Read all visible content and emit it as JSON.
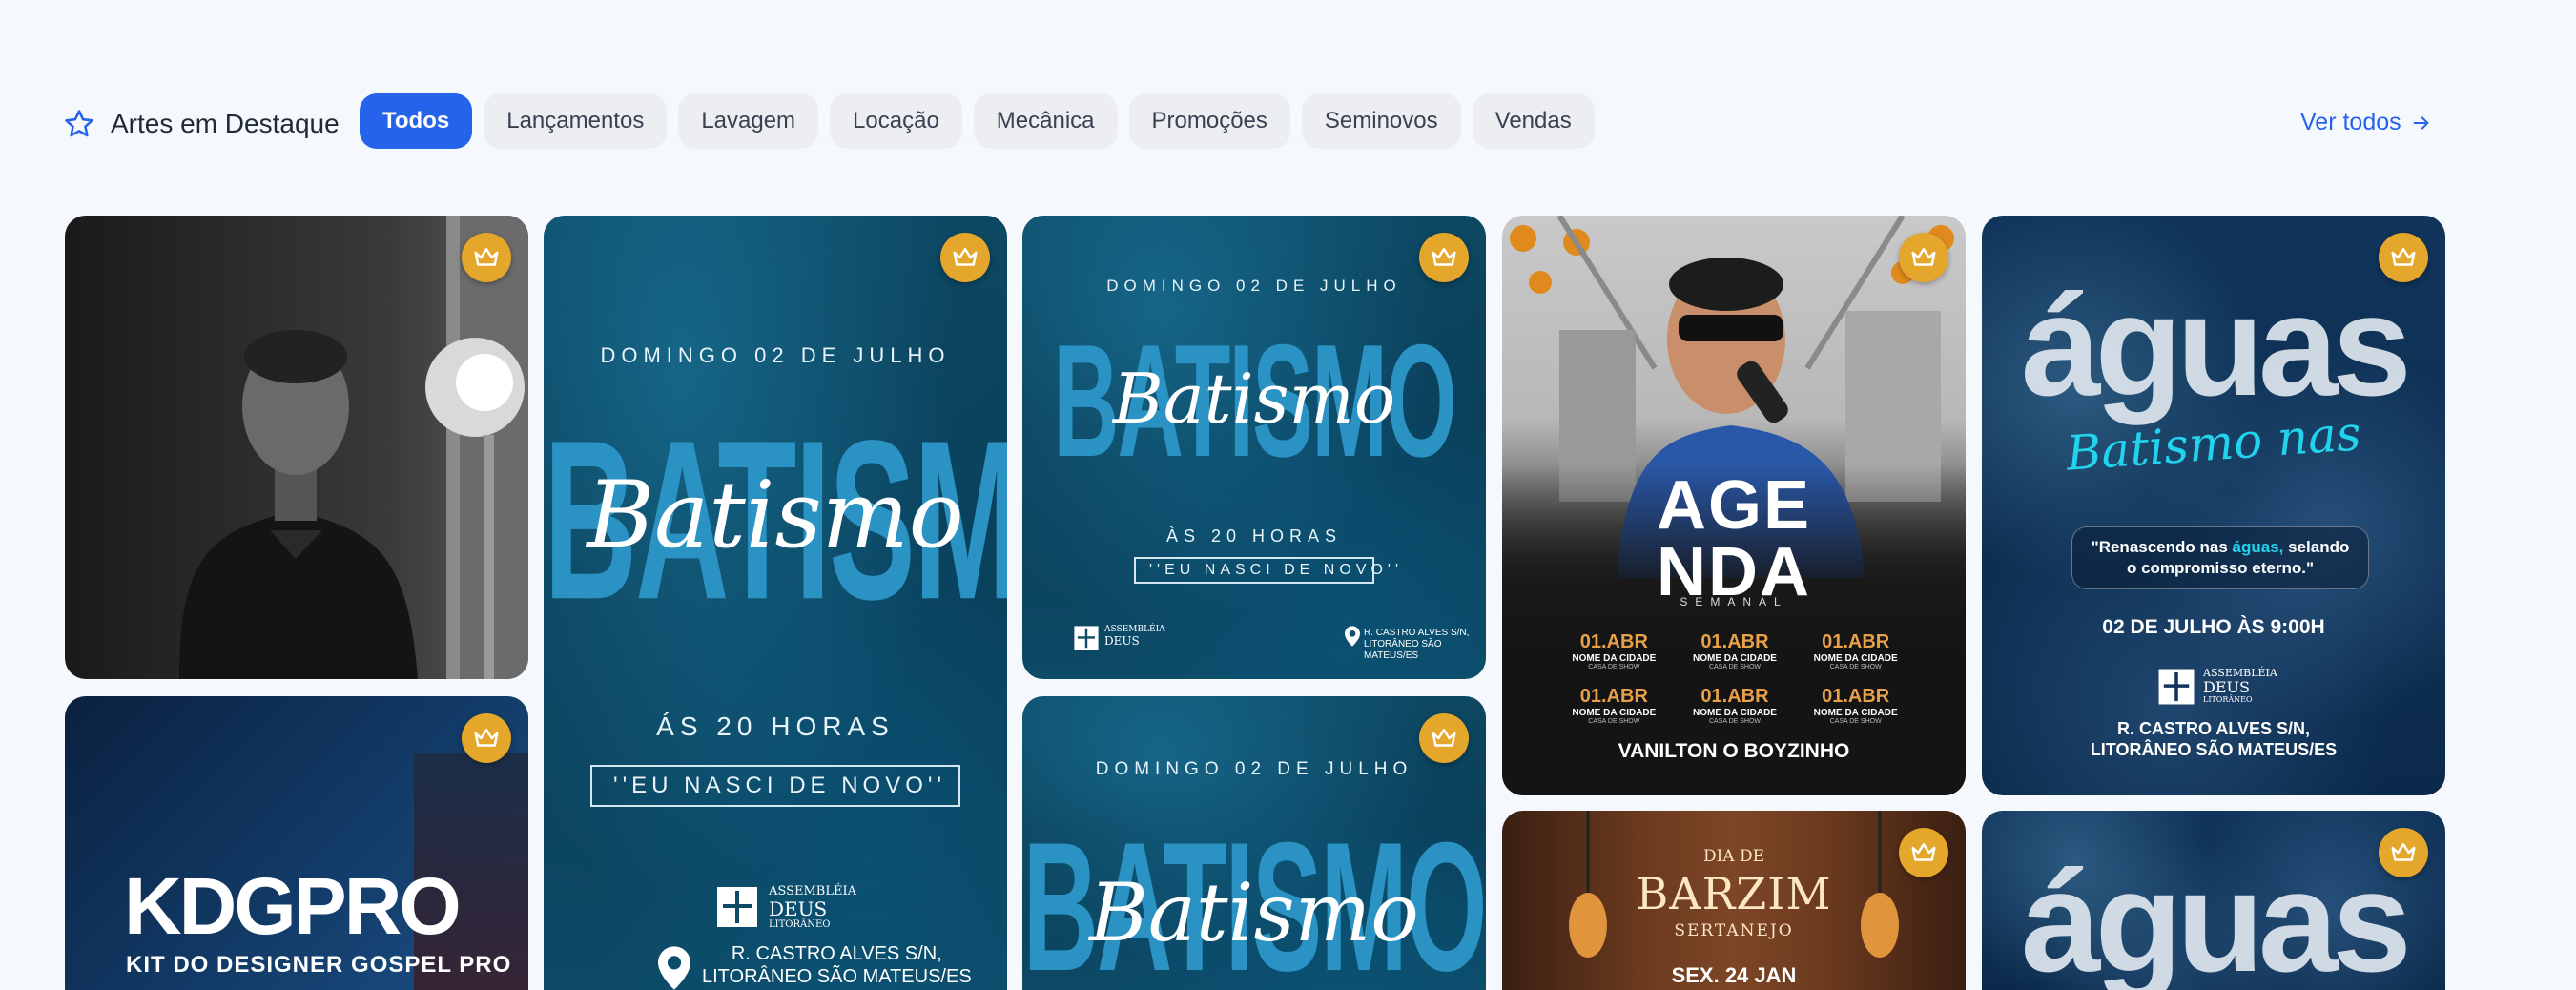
{
  "section": {
    "title": "Artes em Destaque",
    "icon": "star-outline-icon",
    "view_all": "Ver todos"
  },
  "tabs": [
    {
      "label": "Todos",
      "active": true
    },
    {
      "label": "Lançamentos",
      "active": false
    },
    {
      "label": "Lavagem",
      "active": false
    },
    {
      "label": "Locação",
      "active": false
    },
    {
      "label": "Mecânica",
      "active": false
    },
    {
      "label": "Promoções",
      "active": false
    },
    {
      "label": "Seminovos",
      "active": false
    },
    {
      "label": "Vendas",
      "active": false
    }
  ],
  "colors": {
    "accent": "#2563eb",
    "tab_inactive": "#eceef1",
    "crown_badge": "#e4a62b",
    "page_bg": "#f5f8fc"
  },
  "cards": {
    "portrait": {
      "premium": true
    },
    "kdgpro": {
      "logo": "KDGPRO",
      "subtitle": "KIT DO DESIGNER GOSPEL PRO",
      "premium": true
    },
    "batismo_tall": {
      "date": "DOMINGO 02 DE JULHO",
      "big": "BATISMO",
      "script": "Batismo",
      "hours": "ÁS 20 HORAS",
      "quote": "''EU NASCI DE NOVO''",
      "org_line1": "ASSEMBLÉIA",
      "org_line2": "DEUS",
      "org_line3": "LITORÂNEO",
      "address_line1": "R. CASTRO ALVES S/N,",
      "address_line2": "LITORÂNEO SÃO MATEUS/ES",
      "premium": true
    },
    "batismo_small": {
      "date": "DOMINGO 02 DE JULHO",
      "big": "BATISMO",
      "script": "Batismo",
      "hours": "ÀS 20 HORAS",
      "quote": "''EU NASCI DE NOVO''",
      "org_line1": "ASSEMBLÉIA",
      "org_line2": "DEUS",
      "address_line1": "R. CASTRO ALVES S/N,",
      "address_line2": "LITORÂNEO SÃO MATEUS/ES",
      "premium": true
    },
    "batismo_small2": {
      "date": "DOMINGO 02 DE JULHO",
      "big": "BATISMO",
      "script": "Batismo",
      "premium": true
    },
    "agenda": {
      "title_line1": "AGE",
      "title_line2": "NDA",
      "subtitle": "SEMANAL",
      "entries": [
        {
          "date": "01.ABR",
          "city": "NOME DA CIDADE",
          "venue": "CASA DE SHOW"
        },
        {
          "date": "01.ABR",
          "city": "NOME DA CIDADE",
          "venue": "CASA DE SHOW"
        },
        {
          "date": "01.ABR",
          "city": "NOME DA CIDADE",
          "venue": "CASA DE SHOW"
        },
        {
          "date": "01.ABR",
          "city": "NOME DA CIDADE",
          "venue": "CASA DE SHOW"
        },
        {
          "date": "01.ABR",
          "city": "NOME DA CIDADE",
          "venue": "CASA DE SHOW"
        },
        {
          "date": "01.ABR",
          "city": "NOME DA CIDADE",
          "venue": "CASA DE SHOW"
        }
      ],
      "artist": "VANILTON O BOYZINHO",
      "premium": true
    },
    "barzim": {
      "line1": "DIA DE",
      "line2": "BARZIM",
      "line3": "SERTANEJO",
      "date": "SEX. 24 JAN",
      "premium": true
    },
    "aguas": {
      "big": "águas",
      "script": "Batismo nas",
      "quote_line1_a": "\"Renascendo nas ",
      "quote_highlight": "águas,",
      "quote_line1_b": " selando",
      "quote_line2": "o compromisso eterno.\"",
      "date": "02 DE JULHO ÀS 9:00H",
      "org_line1": "ASSEMBLÉIA",
      "org_line2": "DEUS",
      "org_line3": "LITORÂNEO",
      "address_line1": "R. CASTRO ALVES S/N,",
      "address_line2": "LITORÂNEO SÃO MATEUS/ES",
      "premium": true
    },
    "aguas2": {
      "big": "águas",
      "premium": true
    }
  }
}
